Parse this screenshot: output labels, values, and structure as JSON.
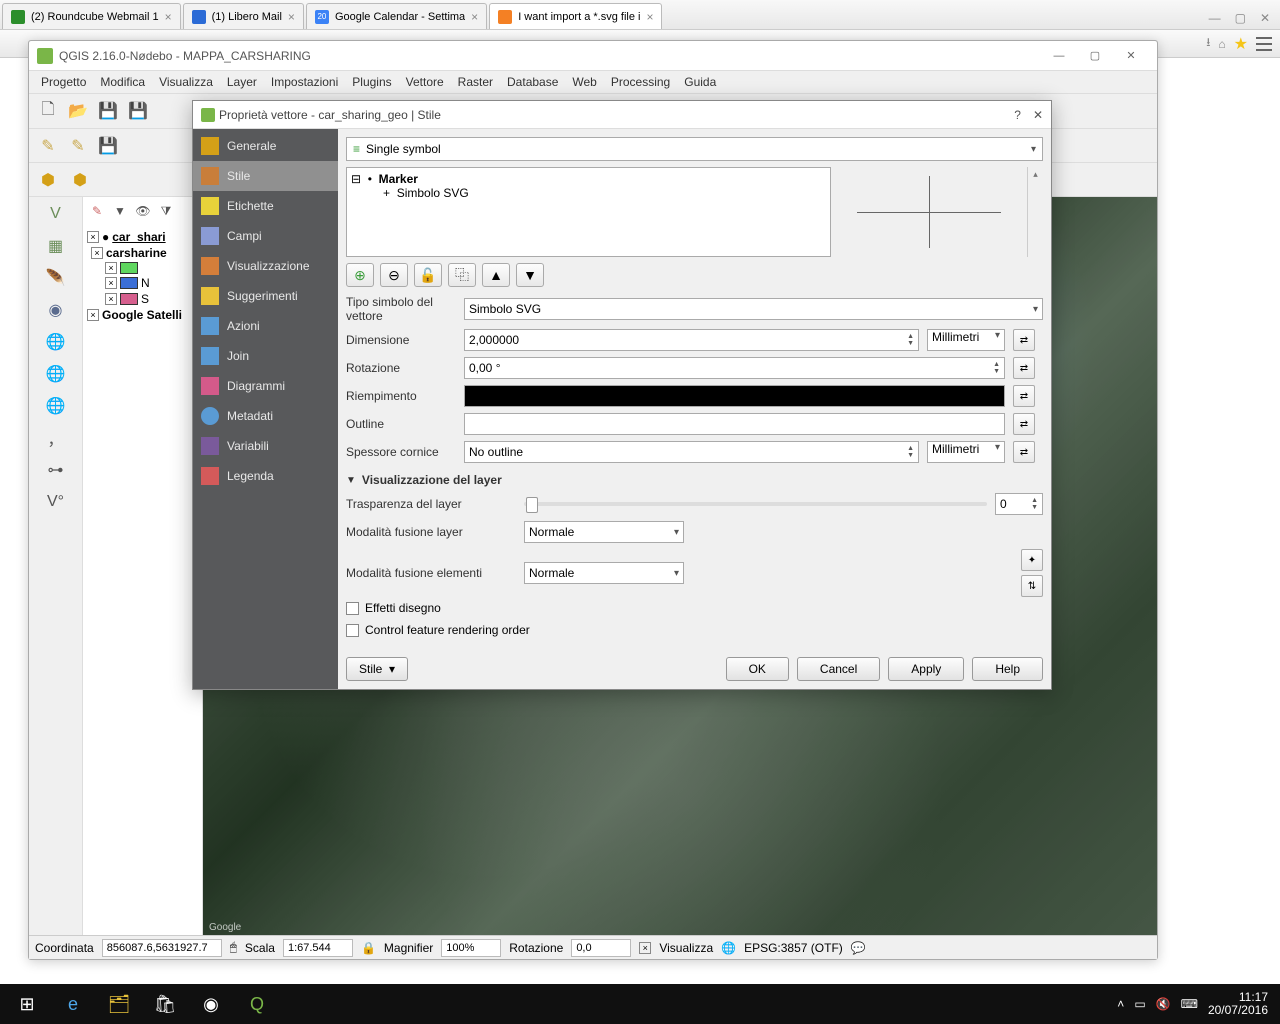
{
  "browser_tabs": [
    {
      "title": "(2) Roundcube Webmail 1",
      "icon": "#2b8e2b"
    },
    {
      "title": "(1) Libero Mail",
      "icon": "#2b6bd6"
    },
    {
      "title": "Google Calendar - Settima",
      "icon": "#3b82f6"
    },
    {
      "title": "I want import a *.svg file i",
      "icon": "#f48024",
      "active": true
    }
  ],
  "qgis": {
    "window_title": "QGIS 2.16.0-Nødebo - MAPPA_CARSHARING",
    "menus": [
      "Progetto",
      "Modifica",
      "Visualizza",
      "Layer",
      "Impostazioni",
      "Plugins",
      "Vettore",
      "Raster",
      "Database",
      "Web",
      "Processing",
      "Guida"
    ],
    "layers": {
      "top": "car_shari",
      "group": "carsharine",
      "sub": [
        "N",
        "S"
      ],
      "bottom": "Google Satelli"
    },
    "statusbar": {
      "coord_label": "Coordinata",
      "coord": "856087.6,5631927.7",
      "scale_label": "Scala",
      "scale": "1:67.544",
      "mag_label": "Magnifier",
      "mag": "100%",
      "rot_label": "Rotazione",
      "rot": "0,0",
      "render": "Visualizza",
      "crs": "EPSG:3857 (OTF)"
    },
    "map_credit": "Google"
  },
  "dialog": {
    "title": "Proprietà vettore - car_sharing_geo | Stile",
    "sidebar": [
      "Generale",
      "Stile",
      "Etichette",
      "Campi",
      "Visualizzazione",
      "Suggerimenti",
      "Azioni",
      "Join",
      "Diagrammi",
      "Metadati",
      "Variabili",
      "Legenda"
    ],
    "sidebar_selected": "Stile",
    "symbol_type": "Single symbol",
    "tree": {
      "root": "Marker",
      "child": "Simbolo SVG"
    },
    "fields": {
      "tipo_label": "Tipo simbolo del vettore",
      "tipo_value": "Simbolo SVG",
      "dim_label": "Dimensione",
      "dim_value": "2,000000",
      "dim_unit": "Millimetri",
      "rot_label": "Rotazione",
      "rot_value": "0,00 °",
      "fill_label": "Riempimento",
      "outline_label": "Outline",
      "border_label": "Spessore cornice",
      "border_value": "No outline",
      "border_unit": "Millimetri"
    },
    "layer_section": {
      "title": "Visualizzazione del layer",
      "transparency_label": "Trasparenza del layer",
      "transparency_value": "0",
      "blend_layer_label": "Modalità fusione layer",
      "blend_layer_value": "Normale",
      "blend_elem_label": "Modalità fusione elementi",
      "blend_elem_value": "Normale",
      "effects": "Effetti disegno",
      "ordering": "Control feature rendering order"
    },
    "footer": {
      "stile": "Stile",
      "ok": "OK",
      "cancel": "Cancel",
      "apply": "Apply",
      "help": "Help"
    }
  },
  "taskbar": {
    "time": "11:17",
    "date": "20/07/2016"
  }
}
